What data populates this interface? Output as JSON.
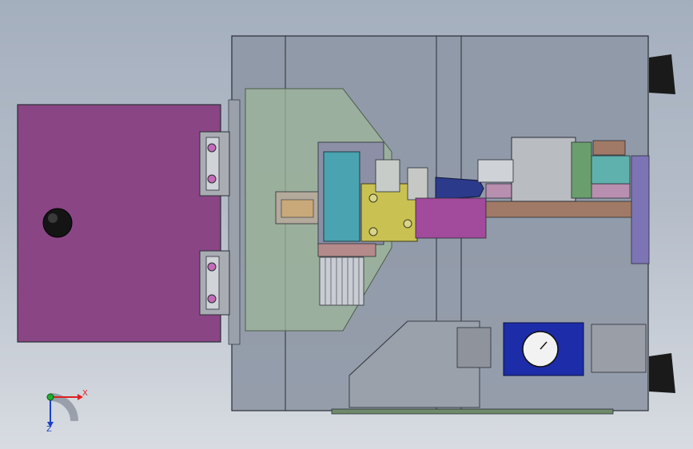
{
  "viewport": {
    "background_top": "#a4afbe",
    "background_bottom": "#d8dce2"
  },
  "colors": {
    "door_panel": "#8a4585",
    "enclosure_glass": "#8e97a5",
    "frame_edge": "#2a2e35",
    "funnel_green": "#9db59a",
    "valve_yellow": "#c9c253",
    "block_teal": "#4aa3b0",
    "plate_brown": "#a07a66",
    "cylinder_green": "#6a9f6d",
    "regulator_blue": "#1d2ca8",
    "axis_red": "#e02020",
    "axis_green": "#1fae2e",
    "axis_blue": "#1c3fc8"
  },
  "axis_triad": {
    "x_label": "X",
    "y_label": "Z"
  }
}
